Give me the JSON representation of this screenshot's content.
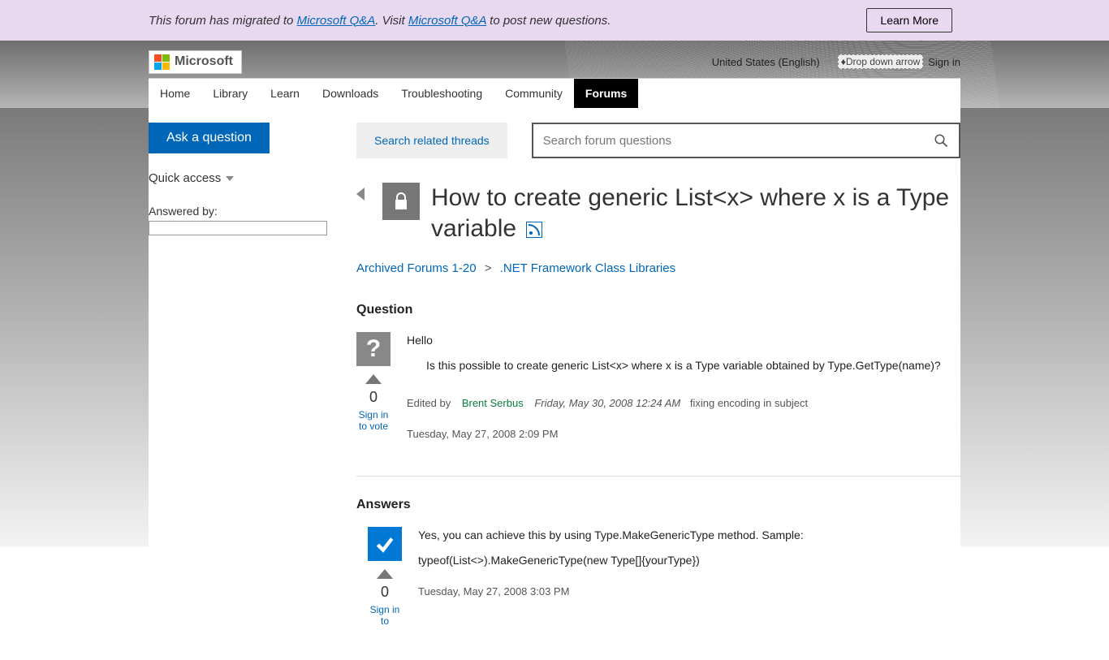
{
  "banner": {
    "prefix": "This forum has migrated to ",
    "link1": "Microsoft Q&A",
    "middle": ". Visit ",
    "link2": "Microsoft Q&A",
    "suffix": " to post new questions.",
    "learn_more": "Learn More"
  },
  "header": {
    "brand": "Microsoft",
    "locale": "United States (English)",
    "dropdown_alt": "Drop down arrow",
    "signin": "Sign in"
  },
  "nav": {
    "items": [
      "Home",
      "Library",
      "Learn",
      "Downloads",
      "Troubleshooting",
      "Community",
      "Forums"
    ],
    "active_index": 6
  },
  "side": {
    "ask": "Ask a question",
    "quick_access": "Quick access",
    "answered_by": "Answered by:"
  },
  "actions": {
    "related": "Search related threads",
    "search_placeholder": "Search forum questions"
  },
  "thread": {
    "title": "How to create generic List<x> where x is a Type variable ",
    "breadcrumb": {
      "a": "Archived Forums 1-20",
      "sep": ">",
      "b": ".NET Framework Class Libraries"
    }
  },
  "question": {
    "heading": "Question",
    "line1": "Hello",
    "line2": "Is this possible to create generic List<x> where x is a Type variable obtained by Type.GetType(name)?",
    "vote_count": "0",
    "sign_in_to_vote": "Sign in to vote",
    "edited_by_label": "Edited by",
    "editor": "Brent Serbus",
    "edit_date": "Friday, May 30, 2008 12:24 AM",
    "edit_reason": "fixing encoding in subject",
    "post_date": "Tuesday, May 27, 2008 2:09 PM"
  },
  "answers": {
    "heading": "Answers",
    "body1": "Yes, you can achieve this by using Type.MakeGenericType method. Sample:",
    "body2": "typeof(List<>).MakeGenericType(new Type[]{yourType})",
    "vote_count": "0",
    "sign_in_to_vote": "Sign in to",
    "post_date": "Tuesday, May 27, 2008 3:03 PM"
  }
}
